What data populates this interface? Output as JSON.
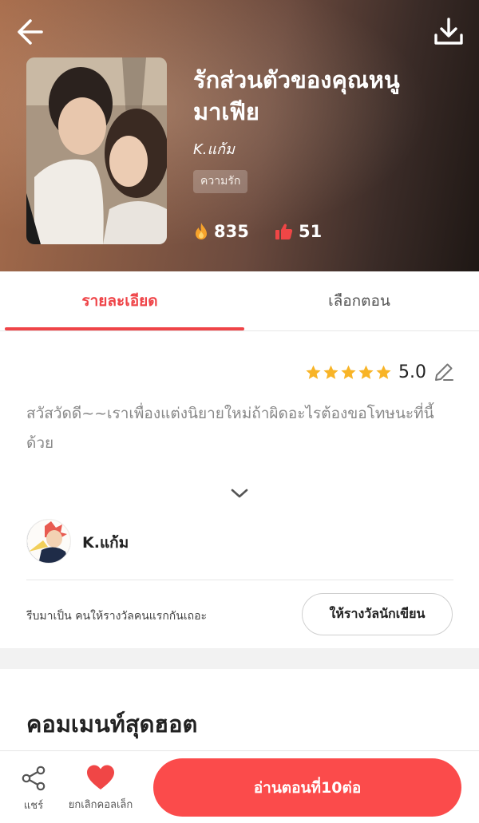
{
  "header": {
    "back_icon": "arrow-left-icon",
    "download_icon": "download-icon",
    "title": "รักส่วนตัวของคุณหนูมาเฟีย",
    "author": "K.แก้ม",
    "genre": "ความรัก",
    "views": "835",
    "likes": "51",
    "views_icon": "fire-icon",
    "likes_icon": "thumbs-up-icon",
    "accent_color": "#ef4448"
  },
  "tabs": [
    {
      "label": "รายละเอียด",
      "active": true
    },
    {
      "label": "เลือกตอน",
      "active": false
    }
  ],
  "details": {
    "rating_value": "5.0",
    "rating_stars": 5,
    "description": "สวัสวัดดี~~เราเพื่องแต่งนิยายใหม่ถ้าผิดอะไรต้องขอโทษนะที่นี้ด้วย",
    "author_name": "K.แก้ม",
    "reward_note": "รีบมาเป็น คนให้รางวัลคนแรกกันเถอะ",
    "reward_button": "ให้รางวัลนักเขียน"
  },
  "comments": {
    "section_title": "คอมเมนท์สุดฮอต"
  },
  "bottom_bar": {
    "share_label": "แชร์",
    "favorite_label": "ยกเลิกคอลเล็ก",
    "read_button": "อ่านตอนที่10ต่อ",
    "button_color": "#fb4b4b"
  }
}
